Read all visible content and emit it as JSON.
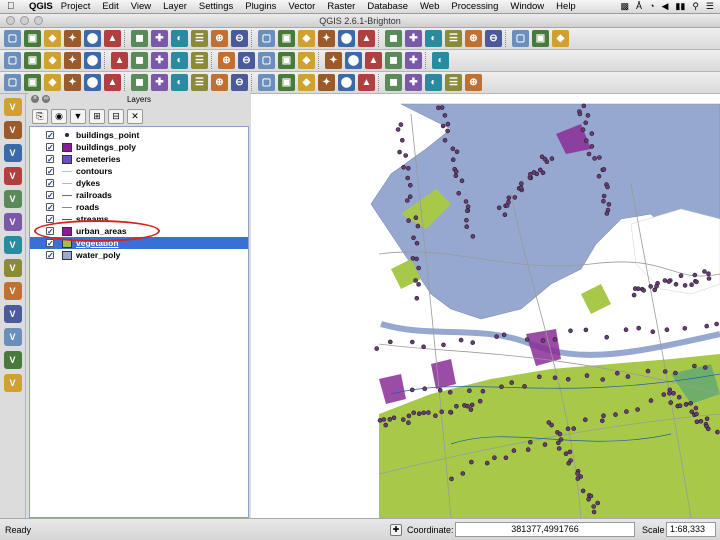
{
  "menubar": {
    "app_name": "QGIS",
    "items": [
      "Project",
      "Edit",
      "View",
      "Layer",
      "Settings",
      "Plugins",
      "Vector",
      "Raster",
      "Database",
      "Web",
      "Processing",
      "Window",
      "Help"
    ]
  },
  "window": {
    "title": "QGIS 2.6.1-Brighton"
  },
  "layers_panel": {
    "title": "Layers",
    "layers": [
      {
        "name": "buildings_point",
        "checked": true,
        "symbol": "point",
        "color": "#2a2a2a"
      },
      {
        "name": "buildings_poly",
        "checked": true,
        "symbol": "fill",
        "color": "#8e1a96"
      },
      {
        "name": "cemeteries",
        "checked": true,
        "symbol": "fill",
        "color": "#6a4fc2"
      },
      {
        "name": "contours",
        "checked": true,
        "symbol": "line",
        "color": "#b5c7a8"
      },
      {
        "name": "dykes",
        "checked": true,
        "symbol": "line",
        "color": "#d7b574"
      },
      {
        "name": "railroads",
        "checked": true,
        "symbol": "line",
        "color": "#8c6b2d"
      },
      {
        "name": "roads",
        "checked": true,
        "symbol": "line",
        "color": "#8a8a8a"
      },
      {
        "name": "streams",
        "checked": true,
        "symbol": "line",
        "color": "#1e5fa0"
      },
      {
        "name": "urban_areas",
        "checked": true,
        "symbol": "fill",
        "color": "#8e1a96"
      },
      {
        "name": "vegetation",
        "checked": true,
        "symbol": "fill",
        "color": "#a8bc48",
        "selected": true
      },
      {
        "name": "water_poly",
        "checked": true,
        "symbol": "fill",
        "color": "#9aa9cf"
      }
    ]
  },
  "statusbar": {
    "status": "Ready",
    "coordinate_label": "Coordinate:",
    "coordinate_value": "381377,4991766",
    "scale_label": "Scale",
    "scale_value": "1:68,333"
  },
  "colors": {
    "water": "#96a8cf",
    "vegetation": "#a8c84a",
    "urban": "#8a2d96",
    "selection": "#3a6fd6",
    "highlight": "#d82020"
  },
  "icons": {
    "toolbar_1": [
      "new-project-icon",
      "open-icon",
      "save-icon",
      "save-as-icon",
      "new-print-composer-icon",
      "composer-manager-icon",
      "pan-icon",
      "pan-to-selection-icon",
      "zoom-in-icon",
      "zoom-out-icon",
      "zoom-actual-icon",
      "zoom-full-icon",
      "zoom-to-selection-icon",
      "zoom-to-layer-icon",
      "zoom-last-icon",
      "zoom-next-icon",
      "refresh-icon",
      "identify-icon",
      "select-icon",
      "deselect-icon",
      "field-calculator-icon",
      "attribute-table-icon",
      "statistics-icon",
      "measure-icon",
      "annotation-icon",
      "map-tips-icon",
      "text-annotation-icon"
    ],
    "toolbar_2": [
      "edit-pencil-icon",
      "save-edits-icon",
      "add-feature-icon",
      "move-feature-icon",
      "node-tool-icon",
      "delete-selected-icon",
      "cut-features-icon",
      "copy-features-icon",
      "paste-features-icon",
      "label-icon",
      "label-pin-icon",
      "label-show-hide-icon",
      "label-move-icon",
      "label-rotate-icon",
      "label-change-icon",
      "csw-icon",
      "python-console-icon",
      "grass-icon",
      "grass-tools-icon",
      "osm-icon",
      "gps-icon"
    ],
    "toolbar_3": [
      "undo-icon",
      "redo-icon",
      "simplify-icon",
      "add-ring-icon",
      "add-part-icon",
      "fill-ring-icon",
      "delete-ring-icon",
      "delete-part-icon",
      "reshape-icon",
      "offset-curve-icon",
      "split-features-icon",
      "split-parts-icon",
      "merge-features-icon",
      "merge-attributes-icon",
      "rotate-point-icon",
      "rotate-feature-icon",
      "digitize-circle-icon",
      "digitize-rect-icon",
      "digitize-ellipse-icon",
      "digitize-polygon-icon",
      "topology-icon",
      "snapping-icon",
      "trace-icon"
    ],
    "vtoolbar": [
      "add-vector-layer-icon",
      "add-raster-layer-icon",
      "add-postgis-layer-icon",
      "add-spatialite-layer-icon",
      "add-mssql-layer-icon",
      "add-oracle-layer-icon",
      "add-wms-layer-icon",
      "add-wcs-layer-icon",
      "add-wfs-layer-icon",
      "new-shapefile-icon",
      "new-spatialite-icon",
      "add-delimited-text-icon",
      "add-virtual-layer-icon"
    ],
    "layers_tools": [
      "add-group-icon",
      "manage-visibility-icon",
      "filter-legend-icon",
      "expand-all-icon",
      "collapse-all-icon",
      "remove-layer-icon"
    ]
  }
}
